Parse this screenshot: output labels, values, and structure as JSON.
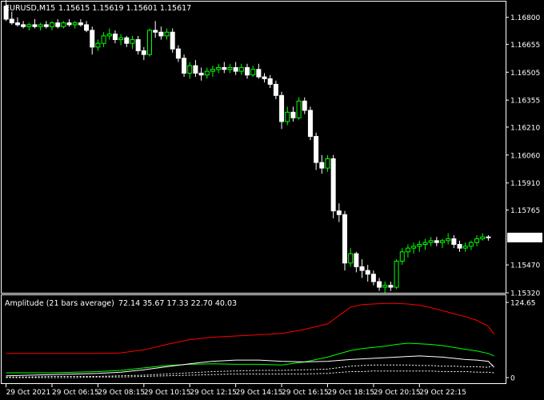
{
  "window": {
    "symbol_label": "EURUSD,M15",
    "ohlc_label": "1.15615 1.15619 1.15601 1.15617"
  },
  "indicator": {
    "name_label": "Amplitude (21 bars average)",
    "separator": "-",
    "values_label": "72.14 35.67 17.33 22.70 40.03"
  },
  "colors": {
    "background": "#000000",
    "frame": "#ffffff",
    "bull_candle": "#00ff00",
    "bear_candle": "#ffffff",
    "red_line": "#ff0000",
    "green_line": "#00ff00",
    "white_line": "#ffffff",
    "dotted_line": "#ffffff",
    "price_tag_bg": "#ffffff",
    "price_tag_text": "#000000"
  },
  "chart_data": [
    {
      "type": "candlestick",
      "symbol": "EURUSD",
      "timeframe": "M15",
      "ylim": [
        1.1532,
        1.1688
      ],
      "yticks": [
        "1.16800",
        "1.16655",
        "1.16505",
        "1.16355",
        "1.16210",
        "1.16060",
        "1.15910",
        "1.15765",
        "1.15617",
        "1.15470",
        "1.15320"
      ],
      "current_price": "1.15617",
      "xticks": [
        "29 Oct 2021",
        "29 Oct 06:15",
        "29 Oct 08:15",
        "29 Oct 10:15",
        "29 Oct 12:15",
        "29 Oct 14:15",
        "29 Oct 16:15",
        "29 Oct 18:15",
        "29 Oct 20:15",
        "29 Oct 22:15"
      ],
      "candles": [
        [
          1.1686,
          1.169,
          1.1678,
          1.1679
        ],
        [
          1.1679,
          1.1683,
          1.1676,
          1.1677
        ],
        [
          1.1677,
          1.168,
          1.1675,
          1.1676
        ],
        [
          1.1676,
          1.1678,
          1.1674,
          1.1675
        ],
        [
          1.1675,
          1.1677,
          1.1673,
          1.1676
        ],
        [
          1.1676,
          1.1679,
          1.1674,
          1.1675
        ],
        [
          1.1675,
          1.1677,
          1.1673,
          1.1676
        ],
        [
          1.1676,
          1.1678,
          1.1674,
          1.1675
        ],
        [
          1.1675,
          1.1678,
          1.1673,
          1.1677
        ],
        [
          1.1677,
          1.1679,
          1.1674,
          1.1675
        ],
        [
          1.1675,
          1.1678,
          1.1674,
          1.1677
        ],
        [
          1.1677,
          1.1679,
          1.1675,
          1.1676
        ],
        [
          1.1676,
          1.1678,
          1.1674,
          1.1677
        ],
        [
          1.1677,
          1.1679,
          1.1675,
          1.1676
        ],
        [
          1.1676,
          1.1678,
          1.1672,
          1.1673
        ],
        [
          1.1673,
          1.1675,
          1.166,
          1.1664
        ],
        [
          1.1664,
          1.1668,
          1.1662,
          1.1666
        ],
        [
          1.1666,
          1.1672,
          1.1664,
          1.167
        ],
        [
          1.167,
          1.1674,
          1.1668,
          1.1671
        ],
        [
          1.1671,
          1.1673,
          1.1666,
          1.1668
        ],
        [
          1.1668,
          1.1671,
          1.1665,
          1.1669
        ],
        [
          1.1669,
          1.167,
          1.1664,
          1.1666
        ],
        [
          1.1666,
          1.167,
          1.1663,
          1.1668
        ],
        [
          1.1668,
          1.167,
          1.166,
          1.1662
        ],
        [
          1.1662,
          1.1664,
          1.1657,
          1.166
        ],
        [
          1.166,
          1.1674,
          1.1659,
          1.1673
        ],
        [
          1.1673,
          1.1678,
          1.1669,
          1.1672
        ],
        [
          1.1672,
          1.1675,
          1.1668,
          1.167
        ],
        [
          1.167,
          1.1674,
          1.1668,
          1.1672
        ],
        [
          1.1672,
          1.1674,
          1.1661,
          1.1663
        ],
        [
          1.1663,
          1.1665,
          1.1656,
          1.1658
        ],
        [
          1.1658,
          1.166,
          1.1648,
          1.165
        ],
        [
          1.165,
          1.1656,
          1.1647,
          1.1654
        ],
        [
          1.1654,
          1.1657,
          1.1648,
          1.165
        ],
        [
          1.165,
          1.1653,
          1.1646,
          1.1649
        ],
        [
          1.1649,
          1.1653,
          1.1647,
          1.1651
        ],
        [
          1.1651,
          1.1654,
          1.1648,
          1.1652
        ],
        [
          1.1652,
          1.1655,
          1.165,
          1.1653
        ],
        [
          1.1653,
          1.1656,
          1.165,
          1.1652
        ],
        [
          1.1652,
          1.1655,
          1.165,
          1.1653
        ],
        [
          1.1653,
          1.1656,
          1.1649,
          1.1651
        ],
        [
          1.1651,
          1.1655,
          1.1649,
          1.1653
        ],
        [
          1.1653,
          1.1655,
          1.1647,
          1.1649
        ],
        [
          1.1649,
          1.1654,
          1.1648,
          1.1652
        ],
        [
          1.1652,
          1.1655,
          1.1647,
          1.1648
        ],
        [
          1.1648,
          1.165,
          1.1645,
          1.1647
        ],
        [
          1.1647,
          1.1649,
          1.1642,
          1.1644
        ],
        [
          1.1644,
          1.1646,
          1.1636,
          1.1638
        ],
        [
          1.1638,
          1.164,
          1.162,
          1.1624
        ],
        [
          1.1624,
          1.1632,
          1.1622,
          1.1629
        ],
        [
          1.1629,
          1.1632,
          1.1624,
          1.1626
        ],
        [
          1.1626,
          1.1637,
          1.1625,
          1.1635
        ],
        [
          1.1635,
          1.1637,
          1.1628,
          1.163
        ],
        [
          1.163,
          1.1632,
          1.1614,
          1.1616
        ],
        [
          1.1616,
          1.1618,
          1.1598,
          1.1602
        ],
        [
          1.1602,
          1.1606,
          1.1596,
          1.1599
        ],
        [
          1.1599,
          1.1606,
          1.1597,
          1.1604
        ],
        [
          1.1604,
          1.1606,
          1.1572,
          1.1576
        ],
        [
          1.1576,
          1.158,
          1.157,
          1.1574
        ],
        [
          1.1574,
          1.1576,
          1.1544,
          1.1548
        ],
        [
          1.1548,
          1.1556,
          1.1546,
          1.1553
        ],
        [
          1.1553,
          1.1554,
          1.1543,
          1.1546
        ],
        [
          1.1546,
          1.155,
          1.154,
          1.1544
        ],
        [
          1.1544,
          1.1547,
          1.1538,
          1.1542
        ],
        [
          1.1542,
          1.1544,
          1.1536,
          1.1538
        ],
        [
          1.1538,
          1.154,
          1.1533,
          1.1535
        ],
        [
          1.1535,
          1.1538,
          1.1532,
          1.1536
        ],
        [
          1.1536,
          1.1538,
          1.1533,
          1.1535
        ],
        [
          1.1535,
          1.155,
          1.1534,
          1.1549
        ],
        [
          1.1549,
          1.1556,
          1.1547,
          1.1554
        ],
        [
          1.1554,
          1.1558,
          1.1551,
          1.1556
        ],
        [
          1.1556,
          1.1559,
          1.1553,
          1.1557
        ],
        [
          1.1557,
          1.156,
          1.1554,
          1.1558
        ],
        [
          1.1558,
          1.1561,
          1.1555,
          1.1559
        ],
        [
          1.1559,
          1.1562,
          1.1557,
          1.156
        ],
        [
          1.156,
          1.1562,
          1.1557,
          1.1559
        ],
        [
          1.1559,
          1.1561,
          1.1556,
          1.156
        ],
        [
          1.156,
          1.1564,
          1.1558,
          1.1561
        ],
        [
          1.1561,
          1.1563,
          1.1556,
          1.1558
        ],
        [
          1.1558,
          1.156,
          1.1554,
          1.1556
        ],
        [
          1.1556,
          1.1559,
          1.1554,
          1.1557
        ],
        [
          1.1557,
          1.156,
          1.1555,
          1.1559
        ],
        [
          1.1559,
          1.1563,
          1.1557,
          1.1561
        ],
        [
          1.1561,
          1.1564,
          1.156,
          1.1562
        ],
        [
          1.1562,
          1.1563,
          1.156,
          1.15617
        ]
      ]
    },
    {
      "type": "line",
      "title": "Amplitude (21 bars average)",
      "ylim": [
        0,
        124.65
      ],
      "yticks": [
        "124.65",
        "0"
      ],
      "x": [
        0,
        4,
        8,
        12,
        16,
        20,
        24,
        28,
        32,
        36,
        40,
        44,
        48,
        52,
        56,
        60,
        62,
        64,
        66,
        68,
        70,
        72,
        74,
        76,
        78,
        80,
        82,
        84,
        85
      ],
      "series": [
        {
          "line": "solid-red",
          "values": [
            40,
            40,
            40,
            40,
            40,
            41,
            46,
            55,
            63,
            67,
            69,
            71,
            73,
            80,
            89,
            117,
            121,
            122,
            123,
            123,
            122,
            120,
            116,
            111,
            106,
            101,
            95,
            85,
            72
          ]
        },
        {
          "line": "solid-green",
          "values": [
            8,
            8,
            8,
            9,
            10,
            12,
            16,
            20,
            22,
            23,
            22,
            22,
            21,
            26,
            34,
            45,
            48,
            50,
            52,
            55,
            57,
            56,
            55,
            53,
            50,
            47,
            44,
            40,
            36
          ]
        },
        {
          "line": "solid-white",
          "values": [
            3,
            4,
            5,
            6,
            7,
            9,
            13,
            18,
            23,
            27,
            29,
            29,
            27,
            26,
            27,
            30,
            31,
            32,
            33,
            34,
            35,
            36,
            35,
            34,
            32,
            30,
            29,
            27,
            17
          ]
        },
        {
          "line": "dotted-white",
          "values": [
            1,
            1,
            2,
            2,
            2,
            3,
            4,
            6,
            8,
            10,
            11,
            12,
            12,
            13,
            14,
            19,
            20,
            21,
            21,
            21,
            21,
            20,
            20,
            19,
            19,
            18,
            18,
            17,
            22
          ]
        },
        {
          "line": "dotted-white",
          "values": [
            0,
            0,
            0,
            0,
            1,
            1,
            2,
            3,
            4,
            5,
            6,
            6,
            6,
            6,
            7,
            10,
            10,
            11,
            11,
            11,
            11,
            11,
            11,
            10,
            10,
            10,
            9,
            9,
            8
          ]
        }
      ]
    }
  ]
}
